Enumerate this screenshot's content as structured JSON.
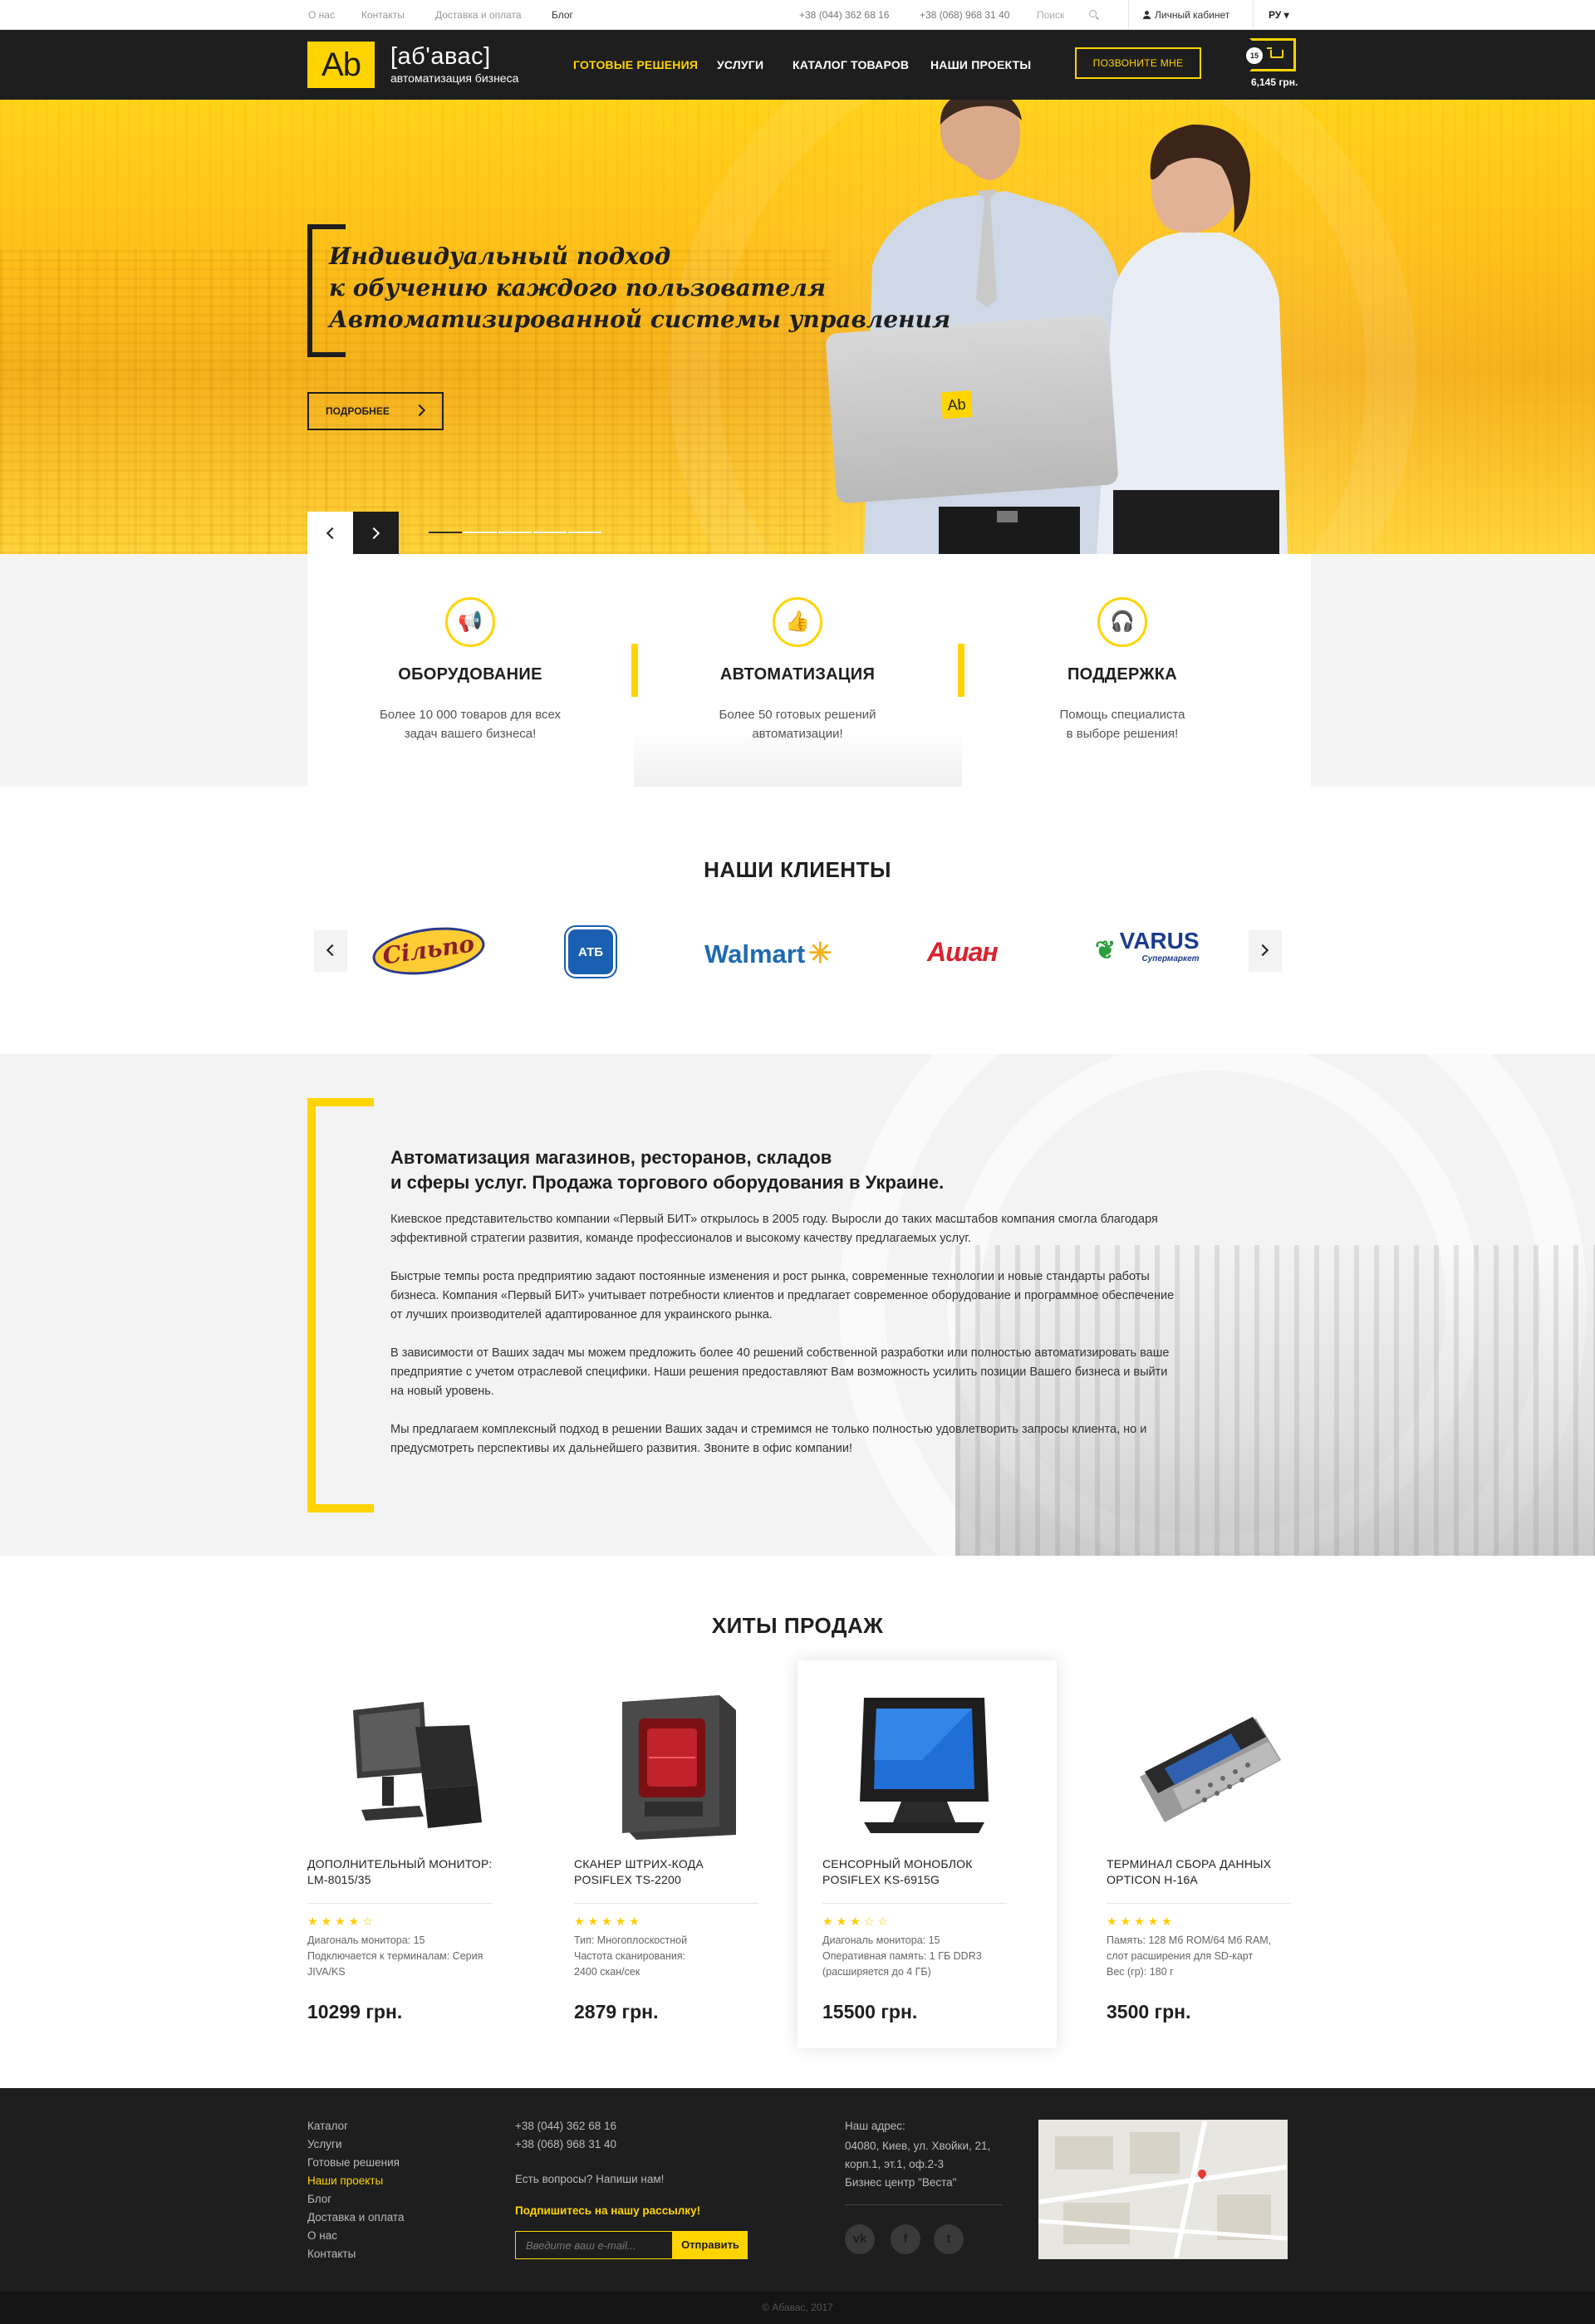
{
  "topbar": {
    "links": [
      "О нас",
      "Контакты",
      "Доставка и оплата",
      "Блог"
    ],
    "phones": [
      "+38 (044) 362 68 16",
      "+38 (068) 968 31 40"
    ],
    "search_placeholder": "Поиск",
    "cabinet": "Личный кабинет",
    "lang": "РУ ▾"
  },
  "header": {
    "logo_mark": "Ab",
    "logo_name": "[аб'авас]",
    "logo_sub": "автоматизация бизнеса",
    "nav": [
      "ГОТОВЫЕ РЕШЕНИЯ",
      "УСЛУГИ",
      "КАТАЛОГ ТОВАРОВ",
      "НАШИ ПРОЕКТЫ"
    ],
    "call_button": "ПОЗВОНИТЕ МНЕ",
    "cart_count": "15",
    "cart_sum": "6,145 грн."
  },
  "hero": {
    "title_lines": [
      "Индивидуальный подход",
      "к обучению каждого пользователя",
      "Автоматизированной системы управления"
    ],
    "more_button": "ПОДРОБНЕЕ",
    "laptop_logo": "Ab",
    "active_slide": 1,
    "slides_total": 5
  },
  "features": [
    {
      "icon": "megaphone-icon",
      "glyph": "📢",
      "title": "ОБОРУДОВАНИЕ",
      "text_lines": [
        "Более 10 000 товаров для всех",
        "задач вашего бизнеса!"
      ]
    },
    {
      "icon": "thumbs-up-icon",
      "glyph": "👍",
      "title": "АВТОМАТИЗАЦИЯ",
      "text_lines": [
        "Более 50 готовых решений",
        "автоматизации!"
      ]
    },
    {
      "icon": "headset-icon",
      "glyph": "🎧",
      "title": "ПОДДЕРЖКА",
      "text_lines": [
        "Помощь специалиста",
        "в выборе решения!"
      ]
    }
  ],
  "clients": {
    "title": "НАШИ КЛИЕНТЫ",
    "logos": [
      "Сільпо",
      "АТБ",
      "Walmart",
      "Ашан",
      "VARUS"
    ],
    "varus_sub": "Супермаркет"
  },
  "about": {
    "title_lines": [
      "Автоматизация магазинов, ресторанов, складов",
      "и сферы услуг. Продажа торгового оборудования в Украине."
    ],
    "paragraphs": [
      [
        "Киевское представительство компании «Первый БИТ» открылось в 2005 году. Выросли до таких масштабов компания смогла благодаря",
        "эффективной стратегии развития, команде профессионалов и высокому качеству предлагаемых услуг."
      ],
      [
        "Быстрые темпы роста предприятию задают постоянные изменения и рост рынка, современные технологии и новые стандарты работы",
        "бизнеса. Компания «Первый БИТ» учитывает потребности клиентов и предлагает современное оборудование и программное обеспечение",
        "от лучших производителей адаптированное для украинского рынка."
      ],
      [
        "В зависимости от Ваших задач мы можем предложить более 40 решений собственной разработки или полностью автоматизировать ваше",
        "предприятие с учетом отраслевой специфики. Наши решения предоставляют Вам возможность усилить позиции Вашего бизнеса и выйти",
        "на новый уровень."
      ],
      [
        "Мы предлагаем комплексный подход в решении Ваших задач и стремимся не только полностью удовлетворить запросы клиента, но и",
        "предусмотреть перспективы их дальнейшего развития. Звоните в офис компании!"
      ]
    ]
  },
  "products": {
    "title": "ХИТЫ ПРОДАЖ",
    "items": [
      {
        "name_lines": [
          "ДОПОЛНИТЕЛЬНЫЙ МОНИТОР:",
          "LM-8015/35"
        ],
        "rating": 4,
        "stars": "★★★★☆",
        "spec_lines": [
          "Диагональ монитора: 15",
          "Подключается к терминалам: Серия",
          "JIVA/KS"
        ],
        "price": "10299 грн."
      },
      {
        "name_lines": [
          "СКАНЕР ШТРИХ-КОДА",
          "POSIFLEX TS-2200"
        ],
        "rating": 5,
        "stars": "★★★★★",
        "spec_lines": [
          "Тип: Многоплоскостной",
          "Частота сканирования:",
          "2400 скан/сек"
        ],
        "price": "2879 грн."
      },
      {
        "name_lines": [
          "СЕНСОРНЫЙ МОНОБЛОК",
          "POSIFLEX KS-6915G"
        ],
        "rating": 3,
        "stars": "★★★☆☆",
        "spec_lines": [
          "Диагональ монитора: 15",
          "Оперативная память: 1 ГБ DDR3",
          "(расширяется до 4 ГБ)"
        ],
        "price": "15500 грн."
      },
      {
        "name_lines": [
          "ТЕРМИНАЛ СБОРА ДАННЫХ",
          "OPTICON H-16A"
        ],
        "rating": 5,
        "stars": "★★★★★",
        "spec_lines": [
          "Память: 128 Мб ROM/64 Мб RAM,",
          "слот расширения для SD-карт",
          "Вес (гр): 180 г"
        ],
        "price": "3500 грн."
      }
    ]
  },
  "footer": {
    "menu": [
      "Каталог",
      "Услуги",
      "Готовые решения",
      "Наши проекты",
      "Блог",
      "Доставка и оплата",
      "О нас",
      "Контакты"
    ],
    "active_menu_index": 3,
    "phones": [
      "+38 (044) 362 68 16",
      "+38 (068) 968 31 40"
    ],
    "question": "Есть вопросы? Напиши нам!",
    "subscribe_title": "Подпишитесь на нашу рассылку!",
    "email_placeholder": "Введите ваш e-mail...",
    "subscribe_button": "Отправить",
    "address_lines": [
      "Наш адрес:",
      "04080, Киев, ул. Хвойки, 21,",
      "корп.1, эт.1, оф.2-3",
      "Бизнес центр \"Веста\""
    ],
    "social": [
      {
        "icon": "vk-icon",
        "glyph": "vk"
      },
      {
        "icon": "facebook-icon",
        "glyph": "f"
      },
      {
        "icon": "twitter-icon",
        "glyph": "t"
      }
    ],
    "copyright": "© Абавас, 2017"
  },
  "colors": {
    "accent": "#ffd400",
    "dark": "#1e1e1e"
  }
}
